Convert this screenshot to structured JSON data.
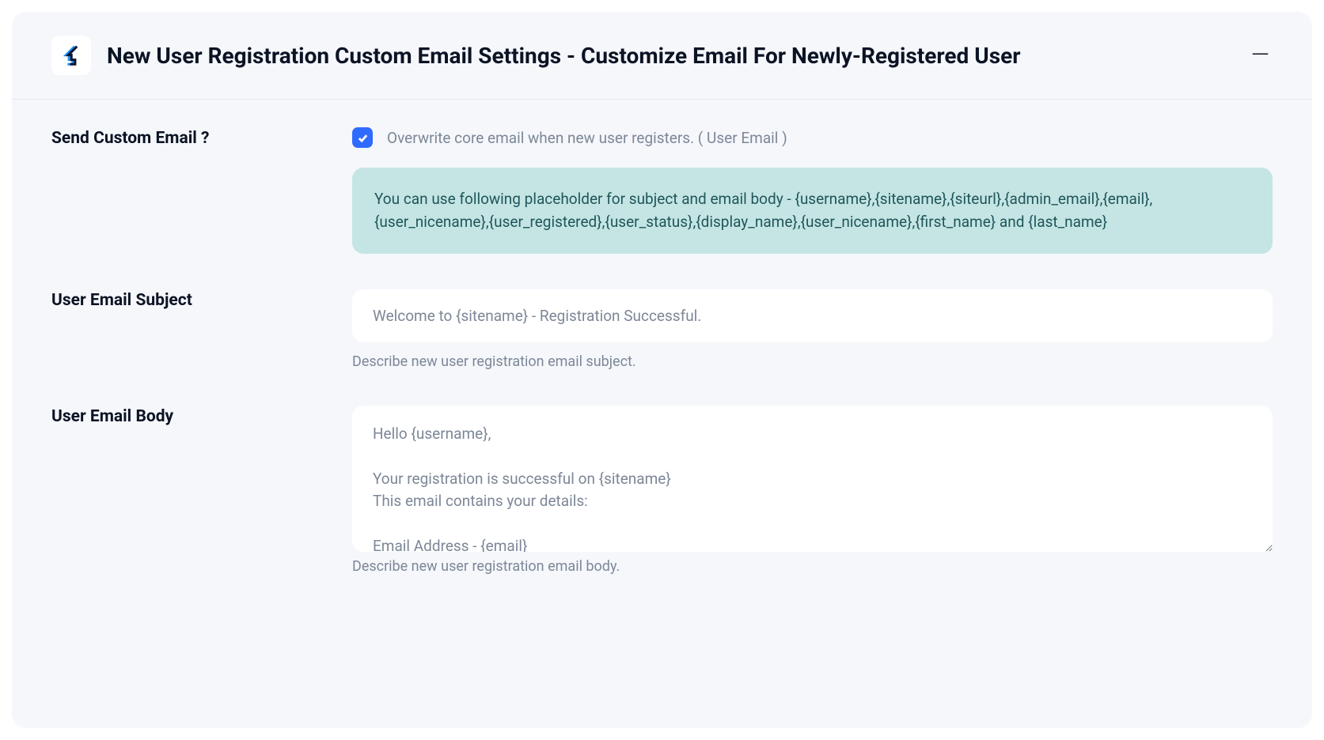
{
  "header": {
    "title": "New User Registration Custom Email Settings - Customize Email For Newly-Registered User"
  },
  "sendCustom": {
    "label": "Send Custom Email ?",
    "checked": true,
    "checkboxLabel": "Overwrite core email when new user registers. ( User Email )",
    "info": "You can use following placeholder for subject and email body - {username},{sitename},{siteurl},{admin_email},{email},{user_nicename},{user_registered},{user_status},{display_name},{user_nicename},{first_name} and {last_name}"
  },
  "subject": {
    "label": "User Email Subject",
    "value": "Welcome to {sitename} - Registration Successful.",
    "helper": "Describe new user registration email subject."
  },
  "body": {
    "label": "User Email Body",
    "value": "Hello {username},\n\nYour registration is successful on {sitename}\nThis email contains your details:\n\nEmail Address - {email}",
    "helper": "Describe new user registration email body."
  }
}
